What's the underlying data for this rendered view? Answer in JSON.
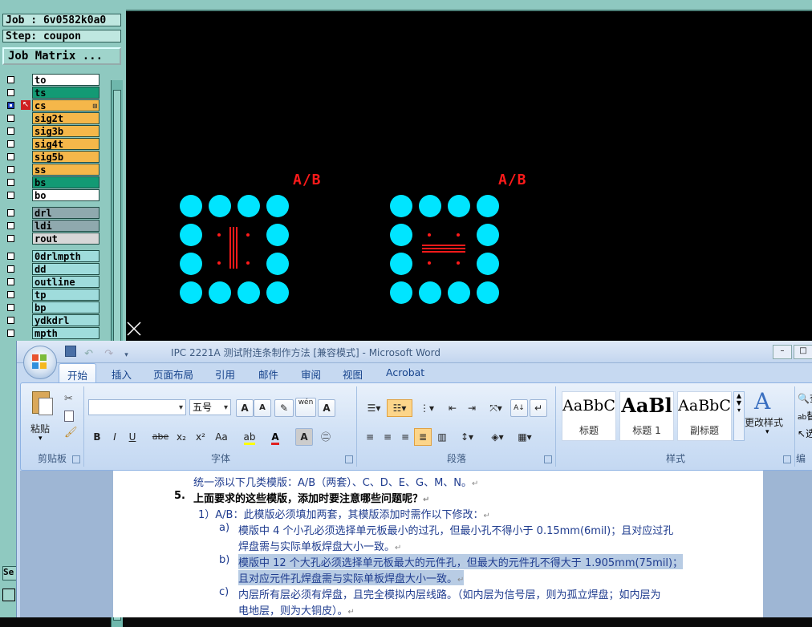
{
  "cam": {
    "job": "Job : 6v0582k0a0",
    "step": "Step: coupon",
    "job_matrix": "Job Matrix ...",
    "layers": [
      {
        "name": "to",
        "color": "white",
        "selected": false
      },
      {
        "name": "ts",
        "color": "green",
        "selected": false
      },
      {
        "name": "cs",
        "color": "orange",
        "selected": true,
        "work": true
      },
      {
        "name": "sig2t",
        "color": "orange",
        "selected": false
      },
      {
        "name": "sig3b",
        "color": "orange",
        "selected": false
      },
      {
        "name": "sig4t",
        "color": "orange",
        "selected": false
      },
      {
        "name": "sig5b",
        "color": "orange",
        "selected": false
      },
      {
        "name": "ss",
        "color": "orange",
        "selected": false
      },
      {
        "name": "bs",
        "color": "green",
        "selected": false
      },
      {
        "name": "bo",
        "color": "white",
        "selected": false
      },
      {
        "name": "drl",
        "color": "grey",
        "selected": false
      },
      {
        "name": "ldi",
        "color": "grey",
        "selected": false
      },
      {
        "name": "rout",
        "color": "lgrey",
        "selected": false
      },
      {
        "name": "0drlmpth",
        "color": "cyan",
        "selected": false
      },
      {
        "name": "dd",
        "color": "cyan",
        "selected": false
      },
      {
        "name": "outline",
        "color": "cyan",
        "selected": false
      },
      {
        "name": "tp",
        "color": "cyan",
        "selected": false
      },
      {
        "name": "bp",
        "color": "cyan",
        "selected": false
      },
      {
        "name": "ydkdrl",
        "color": "cyan",
        "selected": false
      },
      {
        "name": "mpth",
        "color": "cyan",
        "selected": false
      }
    ],
    "canvas_labels": {
      "left": "A/B",
      "right": "A/B"
    },
    "colors": {
      "pad": "#00e5ff",
      "marker": "#ff1a1a",
      "canvas_bg": "#000000"
    }
  },
  "word": {
    "title": "IPC 2221A 测试附连条制作方法 [兼容模式] - Microsoft Word",
    "tabs": [
      "开始",
      "插入",
      "页面布局",
      "引用",
      "邮件",
      "审阅",
      "视图",
      "Acrobat"
    ],
    "active_tab": "开始",
    "ribbon": {
      "clipboard": {
        "paste": "粘贴",
        "label": "剪贴板"
      },
      "font": {
        "name": "",
        "size": "五号",
        "label": "字体",
        "wen": "wén",
        "bold": "B",
        "italic": "I",
        "underline": "U",
        "strike": "abe",
        "sub": "x₂",
        "sup": "x²",
        "case": "Aa",
        "a_big": "A",
        "a_small": "A"
      },
      "paragraph": {
        "label": "段落"
      },
      "styles": {
        "items": [
          {
            "preview": "AaBbC",
            "name": "标题"
          },
          {
            "preview": "AaBl",
            "name": "标题 1"
          },
          {
            "preview": "AaBbC",
            "name": "副标题"
          }
        ],
        "change": "更改样式",
        "label": "样式"
      },
      "editing": {
        "find": "查",
        "replace": "替",
        "select": "选",
        "label": "编"
      }
    },
    "doc_lines": [
      "统一添以下几类模版：A/B（两套）、C、D、E、G、M、N。",
      "上面要求的这些模版，添加时要注意哪些问题呢？",
      "1）A/B：此模版必须填加两套，其模版添加时需作以下修改：",
      "模版中 4 个小孔必须选择单元板最小的过孔，但最小孔不得小于 0.15mm(6mil)；且对应过孔",
      "焊盘需与实际单板焊盘大小一致。",
      "模版中 12 个大孔必须选择单元板最大的元件孔，但最大的元件孔不得大于 1.905mm(75mil)；",
      "且对应元件孔焊盘需与实际单板焊盘大小一致。",
      "内层所有层必须有焊盘，且完全模拟内层线路。（如内层为信号层，则为孤立焊盘；如内层为",
      "电地层，则为大铜皮）。"
    ],
    "list_markers": {
      "five": "5.",
      "a": "a)",
      "b": "b)",
      "c": "c)"
    }
  }
}
